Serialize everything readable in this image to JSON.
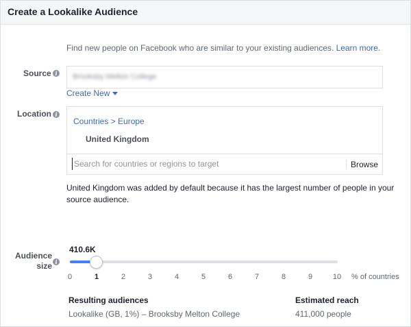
{
  "header": {
    "title": "Create a Lookalike Audience"
  },
  "description": {
    "text": "Find new people on Facebook who are similar to your existing audiences.",
    "link": "Learn more."
  },
  "source": {
    "label": "Source",
    "value": "Brooksby Melton College",
    "create_new": "Create New"
  },
  "location": {
    "label": "Location",
    "breadcrumb": "Countries > Europe",
    "selected": "United Kingdom",
    "search_placeholder": "Search for countries or regions to target",
    "browse": "Browse",
    "note": "United Kingdom was added by default because it has the largest number of people in your source audience."
  },
  "audience_size": {
    "label_line1": "Audience",
    "label_line2": "size",
    "value": "410.6K",
    "selected_percent": 1,
    "ticks": [
      "0",
      "1",
      "2",
      "3",
      "4",
      "5",
      "6",
      "7",
      "8",
      "9",
      "10"
    ],
    "unit": "% of countries"
  },
  "results": {
    "col1_header": "Resulting audiences",
    "col2_header": "Estimated reach",
    "rows": [
      {
        "audience": "Lookalike (GB, 1%) – Brooksby Melton College",
        "reach": "411,000 people"
      }
    ]
  },
  "colors": {
    "accent": "#4267b2",
    "slider_fill": "#4080ff"
  },
  "icons": {
    "info": "info-icon",
    "caret": "caret-down-icon"
  }
}
